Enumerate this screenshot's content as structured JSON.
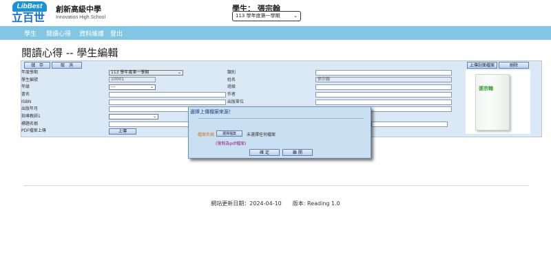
{
  "header": {
    "logo_top": "LibBest",
    "logo_bottom": "立百世",
    "school_name": "創新高級中學",
    "school_name_en": "Innovation High School",
    "student_label": "學生： 張宗翰",
    "semester_selected": "113 學年度第一學期"
  },
  "nav": [
    "學生",
    "閱讀心得",
    "資料維護",
    "登出"
  ],
  "page_title": "閱讀心得 -- 學生編輯",
  "toolbar": {
    "save": "儲　存",
    "cancel": "取　消",
    "upload_cover": "上傳封面檔案",
    "delete": "刪除"
  },
  "form": {
    "year_label": "年度學期",
    "year_value": "113 學年度第一學期",
    "student_id_label": "學生編號",
    "student_id_value": "10001",
    "grade_label": "年級",
    "grade_value": "---",
    "title_label": "書名",
    "isbn_label": "ISBN",
    "pub_date_label": "出版年月",
    "teacher_label": "指導教師1",
    "subtitle_label": "標題名稱",
    "pdf_label": "PDF檔案上傳",
    "pdf_button": "上傳",
    "grade_right_label": "類別",
    "name_label": "姓名",
    "name_value": "張宗翰",
    "class_label": "班級",
    "author_label": "作者",
    "publisher_label": "出版單位"
  },
  "cover": {
    "book_name": "張宗翰"
  },
  "dialog": {
    "title": "選擇上傳檔案來源！",
    "file_label": "檔案名稱",
    "choose_button": "選擇檔案",
    "no_file": "未選擇任何檔案",
    "hint": "(限制為pdf檔案)",
    "ok": "確 定",
    "close": "離 開"
  },
  "footer": {
    "text": "網站更新日期：2024-04-10　　版本: Reading 1.0"
  },
  "colors": {
    "nav": "#81c7e4",
    "form_bg": "#dbe8f6",
    "dialog_bg": "#c9dff2",
    "accent": "#1a93d6"
  }
}
